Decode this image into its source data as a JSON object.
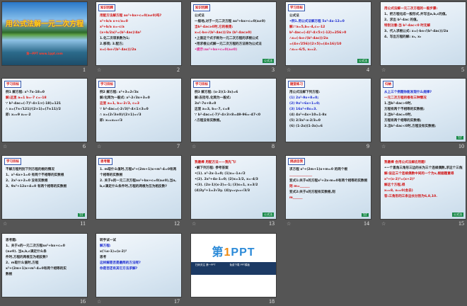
{
  "view": "slide-sorter",
  "colors": {
    "background": "#555555",
    "red": "#d01010",
    "blue": "#1a2ad0",
    "black": "#222222",
    "pink": "#e0208a"
  },
  "slides": [
    {
      "number": "1",
      "type": "cover",
      "title": "用公式法解一元二次方程",
      "subtitle": "第一PPT www.1ppt.com"
    },
    {
      "number": "2",
      "star": "☆",
      "header": "知识回顾",
      "lines": [
        {
          "t": "用配方法解方程 ax²+bx+c=0(a≠0)吗?",
          "c": "red"
        },
        {
          "t": "x²+b/a x+c/a=0",
          "c": "red"
        },
        {
          "t": "x²+b/a x=-c/a",
          "c": "red"
        },
        {
          "t": "(x+b/2a)²=(b²-4ac)/4a²",
          "c": "red"
        },
        {
          "t": "1.化二次项系数为1;",
          "c": "black"
        },
        {
          "t": "2.移项;  3.配方;",
          "c": "black"
        },
        {
          "t": "x=(-b±√(b²-4ac))/2a",
          "c": "red"
        }
      ]
    },
    {
      "number": "3",
      "header": "知识回顾",
      "lines": [
        {
          "t": "公式法",
          "c": "black"
        },
        {
          "t": "一般地,对于一元二次方程 ax²+bx+c=0(a≠0)",
          "c": "black"
        },
        {
          "t": "当b²-4ac≥0时,它的根是:",
          "c": "red"
        },
        {
          "t": "x=(-b±√(b²-4ac))/2a (b²-4ac≥0)",
          "c": "red"
        },
        {
          "t": "•上面这个式子称为一元二次方程的求根公式",
          "c": "black"
        },
        {
          "t": "•用求根公式解一元二次方程的方法称为公式法",
          "c": "black"
        },
        {
          "t": "•提示:ax²+bx+c=0(a≠0)",
          "c": "pink"
        }
      ],
      "badge": "公式法"
    },
    {
      "number": "4",
      "star": "☆",
      "header": "学习目标",
      "lines": [
        {
          "t": "公式法",
          "c": "black"
        },
        {
          "t": "•例1.用公式法解方程 5x²-4x-12=0",
          "c": "blue"
        },
        {
          "t": "解:∵a=5,b=-4,c=-12",
          "c": "red"
        },
        {
          "t": "b²-4ac=(-4)²-4×5×(-12)=256>0",
          "c": "red"
        },
        {
          "t": "∴x=(-b±√(b²-4ac))/2a",
          "c": "red"
        },
        {
          "t": "=(4±√256)/(2×5)=(4±16)/10",
          "c": "red"
        },
        {
          "t": "∴x₁=-6/5, x₂=2.",
          "c": "red"
        }
      ],
      "badge": "公式法"
    },
    {
      "number": "5",
      "star": "☆",
      "lines": [
        {
          "t": "用公式法解一元二次方程的一般步骤:",
          "c": "red"
        },
        {
          "t": "1、把方程化成一般形式,并写出a,b,c的值。",
          "c": "black"
        },
        {
          "t": "2、求出 b²-4ac 的值。",
          "c": "black"
        },
        {
          "t": "特别注意:当 b²-4ac<0 时无解",
          "c": "red"
        },
        {
          "t": "3、代入求根公式: x=(-b±√(b²-4ac))/2a",
          "c": "black"
        },
        {
          "t": "4、写出方程的解: x₁, x₂",
          "c": "black"
        }
      ]
    },
    {
      "number": "6",
      "star": "☆",
      "header": "学习目标",
      "lines": [
        {
          "t": "例1 解方程: x²-7x-18=0",
          "c": "black"
        },
        {
          "t": "解:这里 a=1  b=-7  c=-18",
          "c": "red"
        },
        {
          "t": "∵ b²-4ac=(-7)²-4×1×(-18)=121",
          "c": "black"
        },
        {
          "t": "∴ x=(7±√121)/(2×1)=(7±11)/2",
          "c": "black"
        },
        {
          "t": "即: x₁=9  x₂=-2",
          "c": "black"
        }
      ]
    },
    {
      "number": "7",
      "star": "☆",
      "header": "学习目标",
      "lines": [
        {
          "t": "例2 解方程: x²+3=2√3x",
          "c": "black"
        },
        {
          "t": "解:化简为一般式: x²-2√3x+3=0",
          "c": "black"
        },
        {
          "t": "这里 a=1, b=-2√3, c=3",
          "c": "red"
        },
        {
          "t": "∵ b²-4ac=(-2√3)²-4×1×3=0",
          "c": "black"
        },
        {
          "t": "∴ x=(2√3±0)/(2×1)=√3",
          "c": "black"
        },
        {
          "t": "即: x₁=x₂=√3",
          "c": "black"
        }
      ]
    },
    {
      "number": "8",
      "star": "☆",
      "header": "学习目标",
      "lines": [
        {
          "t": "例3 解方程: (x-2)(1-3x)=6",
          "c": "black"
        },
        {
          "t": "解:去括号,化简为一般式:",
          "c": "black"
        },
        {
          "t": "3x²-7x+8=0",
          "c": "black"
        },
        {
          "t": "这里 a=3, b=-7, c=8",
          "c": "black"
        },
        {
          "t": "∵ b²-4ac=(-7)²-4×3×8=49-96=-47<0",
          "c": "black"
        },
        {
          "t": "∴方程没有实数根。",
          "c": "black"
        }
      ]
    },
    {
      "number": "9",
      "header": "随堂练习",
      "lines": [
        {
          "t": "用公式法解下列方程:",
          "c": "black"
        },
        {
          "t": "(1) 2x²-9x+8=0;",
          "c": "blue"
        },
        {
          "t": "(2) 9x²+6x+1=0;",
          "c": "blue"
        },
        {
          "t": "(3) 16x²+8x=3.",
          "c": "blue"
        },
        {
          "t": "(4) 4x²+4x+10=1-8x",
          "c": "black"
        },
        {
          "t": "(5) 2/3x²-x-2/3=0",
          "c": "black"
        },
        {
          "t": "(6) (1-2x)(1-3x)=6",
          "c": "black"
        }
      ]
    },
    {
      "number": "10",
      "star": "☆",
      "header": "归纳",
      "lines": [
        {
          "t": "从上三个例题你能发现什么规律?",
          "c": "blue"
        },
        {
          "t": "一元二次方程的根有三种情况",
          "c": "red"
        },
        {
          "t": "1.当b²-4ac>0时,",
          "c": "black"
        },
        {
          "t": "方程有两个不相等的实数根;",
          "c": "black"
        },
        {
          "t": "2.当b²-4ac=0时,",
          "c": "black"
        },
        {
          "t": "方程有两个相等的实数根;",
          "c": "black"
        },
        {
          "t": "3.当b²-4ac<0时,方程没有实数根;",
          "c": "black"
        }
      ],
      "badge": "TIT"
    },
    {
      "number": "11",
      "star": "☆",
      "header": "学习目标",
      "lines": [
        {
          "t": "不解方程判别下列方程的根的情况",
          "c": "black"
        },
        {
          "t": "1、x²-6x+1=0 有两个不相等的实数根",
          "c": "black"
        },
        {
          "t": "2、2x²-x+2=0 没有实数根",
          "c": "black"
        },
        {
          "t": "3、9x²+12x+4=0 有两个相等的实数根",
          "c": "black"
        }
      ],
      "badge": "TIT"
    },
    {
      "number": "12",
      "header": "思考题",
      "lines": [
        {
          "t": "1. m取什么值时,方程x²+(2m+1)x+m²-4=0有两",
          "c": "black"
        },
        {
          "t": "个相等的实数根",
          "c": "black"
        },
        {
          "t": "2. 关于x的一元二次方程ax²+bx+c=0(a≠0),当a,",
          "c": "black"
        },
        {
          "t": "b,c满足什么条件时,方程的两根为互为相反数?",
          "c": "black"
        }
      ]
    },
    {
      "number": "13",
      "star": "☆",
      "lines": [
        {
          "t": "我最棒  用配方法——我先飞!",
          "c": "red"
        },
        {
          "t": "•解下列方程:        参考答案",
          "c": "black"
        },
        {
          "t": "•(1). x²-2x-1=0;   (1)x=-1±√2",
          "c": "black"
        },
        {
          "t": "•(2). 2x²+4x-1=0;  (2)x=1/2, x=-4/3",
          "c": "black"
        },
        {
          "t": "•(3). (2x-1)(x-2)=-1;  (3)x=1, x=3/2",
          "c": "black"
        },
        {
          "t": "(4)3y²+1=2√3y.   (4)y₁=y₂=√3/3",
          "c": "black"
        }
      ],
      "badge": "公式法"
    },
    {
      "number": "14",
      "star": "☆",
      "header": "挑战自我",
      "lines": [
        {
          "t": "求方程 x²+(2m+1)x+m=0 的两个根",
          "c": "black"
        },
        {
          "t": "______________",
          "c": "red"
        },
        {
          "t": "变式1:关于x的方程x²+2x-m=0有两个相等的实数根",
          "c": "black"
        },
        {
          "t": "则 m=______",
          "c": "red"
        },
        {
          "t": "变式2:关于x的方程有实数根,则",
          "c": "black"
        },
        {
          "t": "m______",
          "c": "red"
        }
      ],
      "badge": "TIT"
    },
    {
      "number": "15",
      "star": "☆",
      "lines": [
        {
          "t": "我最棒  会用公式法解应用题!",
          "c": "red"
        },
        {
          "t": "•一个直角三角形三边的长为三个连续偶数,求这个三角形的三边长",
          "c": "black"
        },
        {
          "t": "解:设这三个连续偶数中间的一个为x,根据题意得",
          "c": "red"
        },
        {
          "t": "x²+(x-2)²=(x+2)²",
          "c": "red"
        },
        {
          "t": "解这个方程,得",
          "c": "red"
        },
        {
          "t": "x₁=8, x₂=0(舍去)",
          "c": "red"
        },
        {
          "t": "答:三角形的三条边长分别为6,8,10.",
          "c": "red"
        }
      ],
      "badge": "公式法"
    },
    {
      "number": "16",
      "lines": [
        {
          "t": "思考题:",
          "c": "black"
        },
        {
          "t": "1、关于x的一元二次方程ax²+bx+c=0",
          "c": "black"
        },
        {
          "t": "(a≠0). 当a,b,c满足什么条",
          "c": "black"
        },
        {
          "t": "件时,方程的两根互为相反数?",
          "c": "black"
        },
        {
          "t": "2、m取什么值时,方程",
          "c": "black"
        },
        {
          "t": "x²+(2m+1)x+m²-4=0有两个相等的实",
          "c": "black"
        },
        {
          "t": "数根",
          "c": "black"
        }
      ]
    },
    {
      "number": "17",
      "star": "☆",
      "lines": [
        {
          "t": "转手试一试",
          "c": "black"
        },
        {
          "t": "解方程:",
          "c": "blue"
        },
        {
          "t": "x(½x-1)=(x-2)²",
          "c": "black"
        },
        {
          "t": "思考",
          "c": "black"
        },
        {
          "t": "这样解是否是最简的方法呢?",
          "c": "blue"
        },
        {
          "t": "你是否还有其它方法求解?",
          "c": "blue"
        }
      ]
    },
    {
      "number": "18",
      "type": "brand",
      "logo_a": "第",
      "logo_b": "1",
      "logo_c": "PPT",
      "band_left": "扫码关注 第一PPT",
      "band_right": "免费下载 PPT模板"
    }
  ]
}
